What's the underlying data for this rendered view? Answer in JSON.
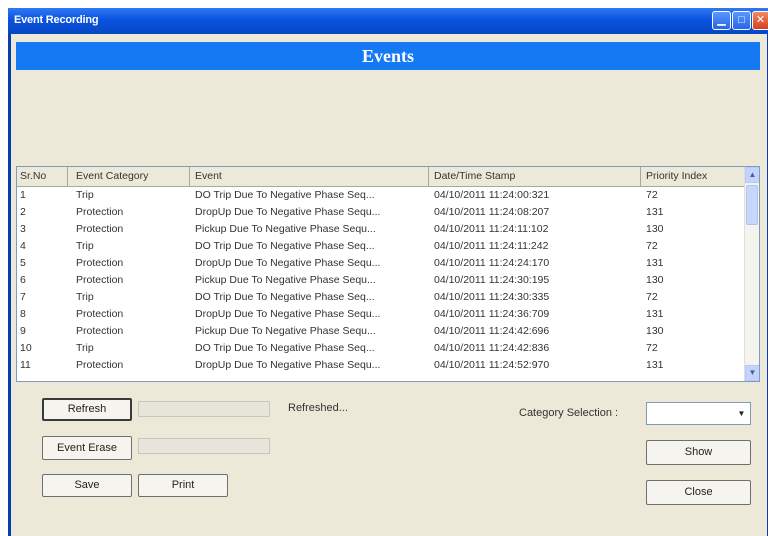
{
  "window": {
    "title": "Event Recording"
  },
  "banner": {
    "title": "Events"
  },
  "table": {
    "columns": [
      "Sr.No",
      "Event Category",
      "Event",
      "Date/Time Stamp",
      "Priority Index"
    ],
    "rows": [
      [
        "1",
        "Trip",
        "DO Trip Due To Negative Phase Seq...",
        "04/10/2011  11:24:00:321",
        "72"
      ],
      [
        "2",
        "Protection",
        "DropUp Due To Negative Phase Sequ...",
        "04/10/2011  11:24:08:207",
        "131"
      ],
      [
        "3",
        "Protection",
        "Pickup Due To Negative Phase Sequ...",
        "04/10/2011  11:24:11:102",
        "130"
      ],
      [
        "4",
        "Trip",
        "DO Trip Due To Negative Phase Seq...",
        "04/10/2011  11:24:11:242",
        "72"
      ],
      [
        "5",
        "Protection",
        "DropUp Due To Negative Phase Sequ...",
        "04/10/2011  11:24:24:170",
        "131"
      ],
      [
        "6",
        "Protection",
        "Pickup Due To Negative Phase Sequ...",
        "04/10/2011  11:24:30:195",
        "130"
      ],
      [
        "7",
        "Trip",
        "DO Trip Due To Negative Phase Seq...",
        "04/10/2011  11:24:30:335",
        "72"
      ],
      [
        "8",
        "Protection",
        "DropUp Due To Negative Phase Sequ...",
        "04/10/2011  11:24:36:709",
        "131"
      ],
      [
        "9",
        "Protection",
        "Pickup Due To Negative Phase Sequ...",
        "04/10/2011  11:24:42:696",
        "130"
      ],
      [
        "10",
        "Trip",
        "DO Trip Due To Negative Phase Seq...",
        "04/10/2011  11:24:42:836",
        "72"
      ],
      [
        "11",
        "Protection",
        "DropUp Due To Negative Phase Sequ...",
        "04/10/2011  11:24:52:970",
        "131"
      ]
    ]
  },
  "controls": {
    "refresh_label": "Refresh",
    "refresh_status": "Refreshed...",
    "erase_label": "Event Erase",
    "save_label": "Save",
    "print_label": "Print",
    "category_label": "Category Selection :",
    "category_value": "",
    "show_label": "Show",
    "close_label": "Close"
  },
  "icons": {
    "minimize": "minimize-icon",
    "maximize": "maximize-icon",
    "close": "close-icon",
    "scroll_up": "arrow-up-icon",
    "scroll_down": "arrow-down-icon",
    "dropdown": "chevron-down-icon"
  },
  "colors": {
    "titlebar": "#0a53df",
    "banner": "#1479f2",
    "window": "#ece9d8",
    "close_button": "#d4411c"
  }
}
